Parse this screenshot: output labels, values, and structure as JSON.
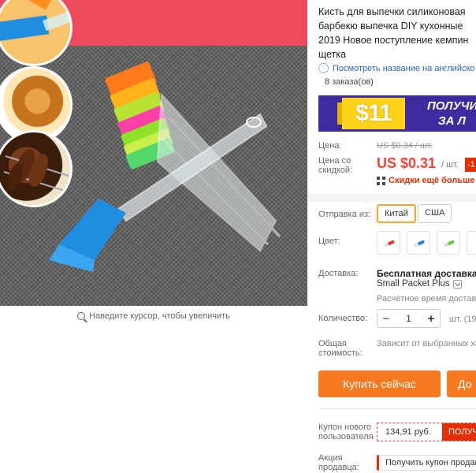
{
  "product": {
    "title_lines": [
      "Кисть для выпечки силиконовая",
      "барбекю выпечка DIY кухонные",
      "2019 Новое поступление кемпин",
      "щетка"
    ],
    "translate_link": "Посмотреть название на английско",
    "orders": "8 заказа(ов)",
    "zoom_hint": "Наведите курсор, чтобы увеличить"
  },
  "promo": {
    "amount": "$11",
    "line1": "ПОЛУЧИ",
    "line2": "ЗА Л"
  },
  "price": {
    "label": "Цена:",
    "old": "US $0.34 / шт.",
    "discount_label_1": "Цена со",
    "discount_label_2": "скидкой:",
    "current": "US $0.31",
    "per_unit": "/ шт.",
    "badge": "-1",
    "more_discounts": "Скидки ещё больше в"
  },
  "shipping": {
    "label": "Отправка из:",
    "options": [
      "Китай",
      "США"
    ],
    "selected": "Китай"
  },
  "color": {
    "label": "Цвет:",
    "swatches": [
      "red",
      "blue",
      "green"
    ]
  },
  "delivery": {
    "label": "Доставка:",
    "title": "Бесплатная доставка в R",
    "method": "Small Packet Plus",
    "estimate": "Расчётное время доставк"
  },
  "quantity": {
    "label": "Количество:",
    "value": "1",
    "minus": "−",
    "plus": "+",
    "unit": "шт. (19"
  },
  "total": {
    "label_1": "Общая",
    "label_2": "стоимость:",
    "note": "Зависит от выбранных хар"
  },
  "actions": {
    "buy_now": "Купить сейчас",
    "add_to_cart": "До"
  },
  "coupons": {
    "new_user_label_1": "Купон нового",
    "new_user_label_2": "пользователя",
    "new_user_value": "134,91 руб.",
    "get": "ПОЛУЧ",
    "seller_label_1": "Акция",
    "seller_label_2": "продавца:",
    "seller_text": "Получить купон продав"
  },
  "colors": {
    "accent_orange": "#f77a20",
    "price_red": "#f44336",
    "promo_purple": "#3f2ba0",
    "promo_yellow": "#ffd21a"
  }
}
